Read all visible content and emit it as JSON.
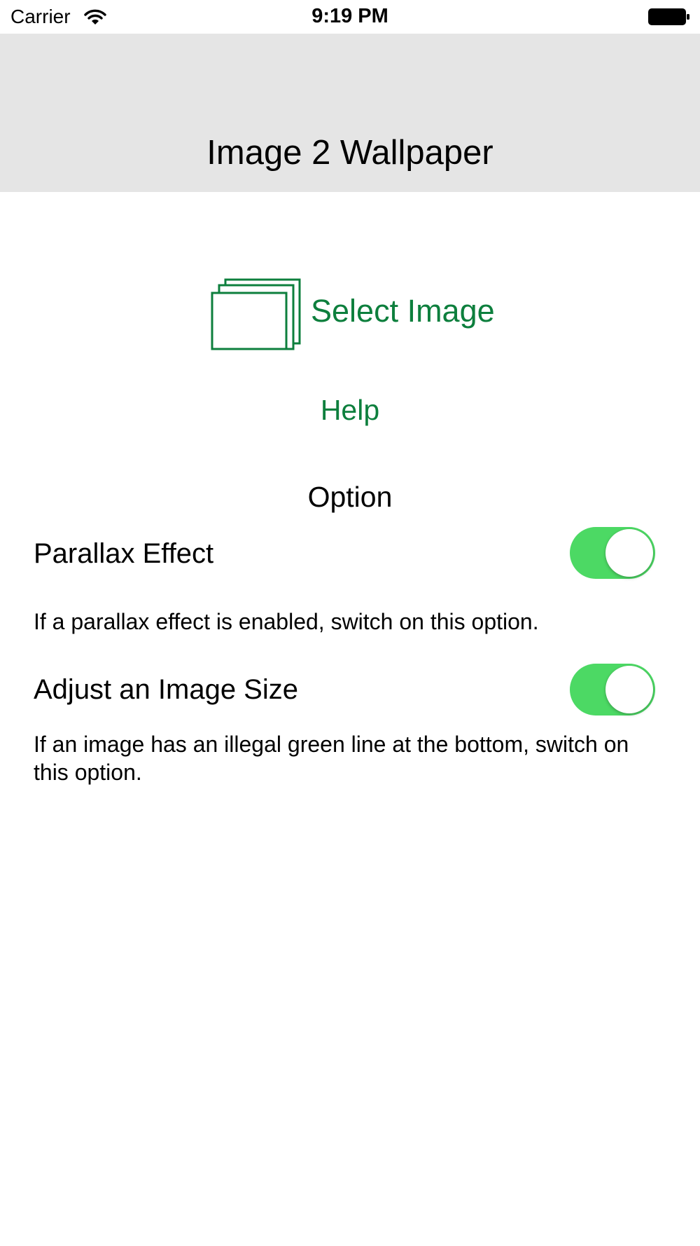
{
  "status_bar": {
    "carrier": "Carrier",
    "time": "9:19 PM",
    "wifi_icon": "wifi-icon",
    "battery_icon": "battery-icon"
  },
  "nav": {
    "title": "Image 2 Wallpaper"
  },
  "main": {
    "select_image_label": "Select Image",
    "select_image_icon": "image-stack-icon",
    "help_label": "Help",
    "option_heading": "Option"
  },
  "options": [
    {
      "label": "Parallax Effect",
      "description": "If a parallax effect is enabled, switch on this option.",
      "enabled": true
    },
    {
      "label": "Adjust an Image Size",
      "description": "If an image has an illegal green line at the bottom, switch on this option.",
      "enabled": true
    }
  ],
  "colors": {
    "accent": "#0d7f3d",
    "toggle_on": "#4cd964",
    "nav_background": "#e5e5e5"
  }
}
